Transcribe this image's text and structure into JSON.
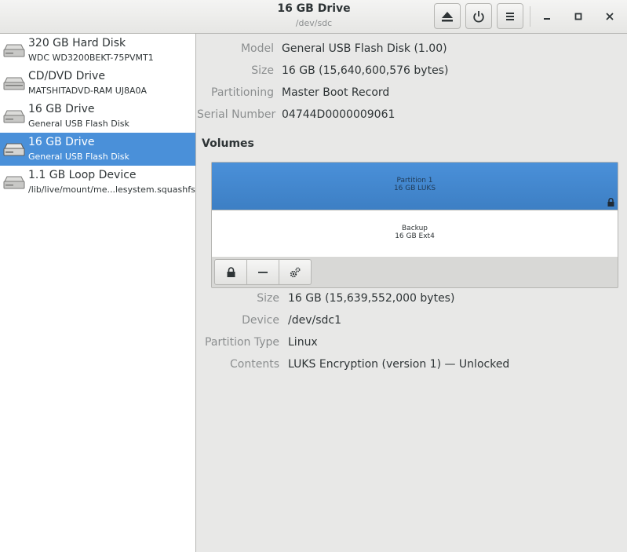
{
  "header": {
    "title": "16 GB Drive",
    "subtitle": "/dev/sdc",
    "buttons": [
      "eject-icon",
      "power-icon",
      "menu-icon"
    ],
    "window_controls": [
      "minimize-icon",
      "maximize-icon",
      "close-icon"
    ]
  },
  "sidebar": {
    "items": [
      {
        "name": "320 GB Hard Disk",
        "desc": "WDC WD3200BEKT-75PVMT1",
        "icon": "harddisk-icon",
        "selected": false
      },
      {
        "name": "CD/DVD Drive",
        "desc": "MATSHITADVD-RAM UJ8A0A",
        "icon": "optical-drive-icon",
        "selected": false
      },
      {
        "name": "16 GB Drive",
        "desc": "General USB Flash Disk",
        "icon": "usb-drive-icon",
        "selected": false
      },
      {
        "name": "16 GB Drive",
        "desc": "General USB Flash Disk",
        "icon": "usb-drive-icon",
        "selected": true
      },
      {
        "name": "1.1 GB Loop Device",
        "desc": "/lib/live/mount/me...lesystem.squashfs",
        "icon": "loop-device-icon",
        "selected": false
      }
    ]
  },
  "drive": {
    "model_label": "Model",
    "model": "General USB Flash Disk (1.00)",
    "size_label": "Size",
    "size": "16 GB (15,640,600,576 bytes)",
    "partitioning_label": "Partitioning",
    "partitioning": "Master Boot Record",
    "serial_label": "Serial Number",
    "serial": "04744D0000009061"
  },
  "volumes": {
    "heading": "Volumes",
    "partitions": [
      {
        "name": "Partition 1",
        "desc": "16 GB LUKS",
        "selected": true
      },
      {
        "name": "Backup",
        "desc": "16 GB Ext4",
        "selected": false
      }
    ],
    "toolbar": [
      "lock-icon",
      "minus-icon",
      "gears-icon"
    ]
  },
  "partition": {
    "size_label": "Size",
    "size": "16 GB (15,639,552,000 bytes)",
    "device_label": "Device",
    "device": "/dev/sdc1",
    "type_label": "Partition Type",
    "type": "Linux",
    "contents_label": "Contents",
    "contents": "LUKS Encryption (version 1) — Unlocked"
  },
  "colors": {
    "accent": "#4a90d9",
    "sidebar_bg": "#ffffff",
    "main_bg": "#e8e8e7"
  }
}
